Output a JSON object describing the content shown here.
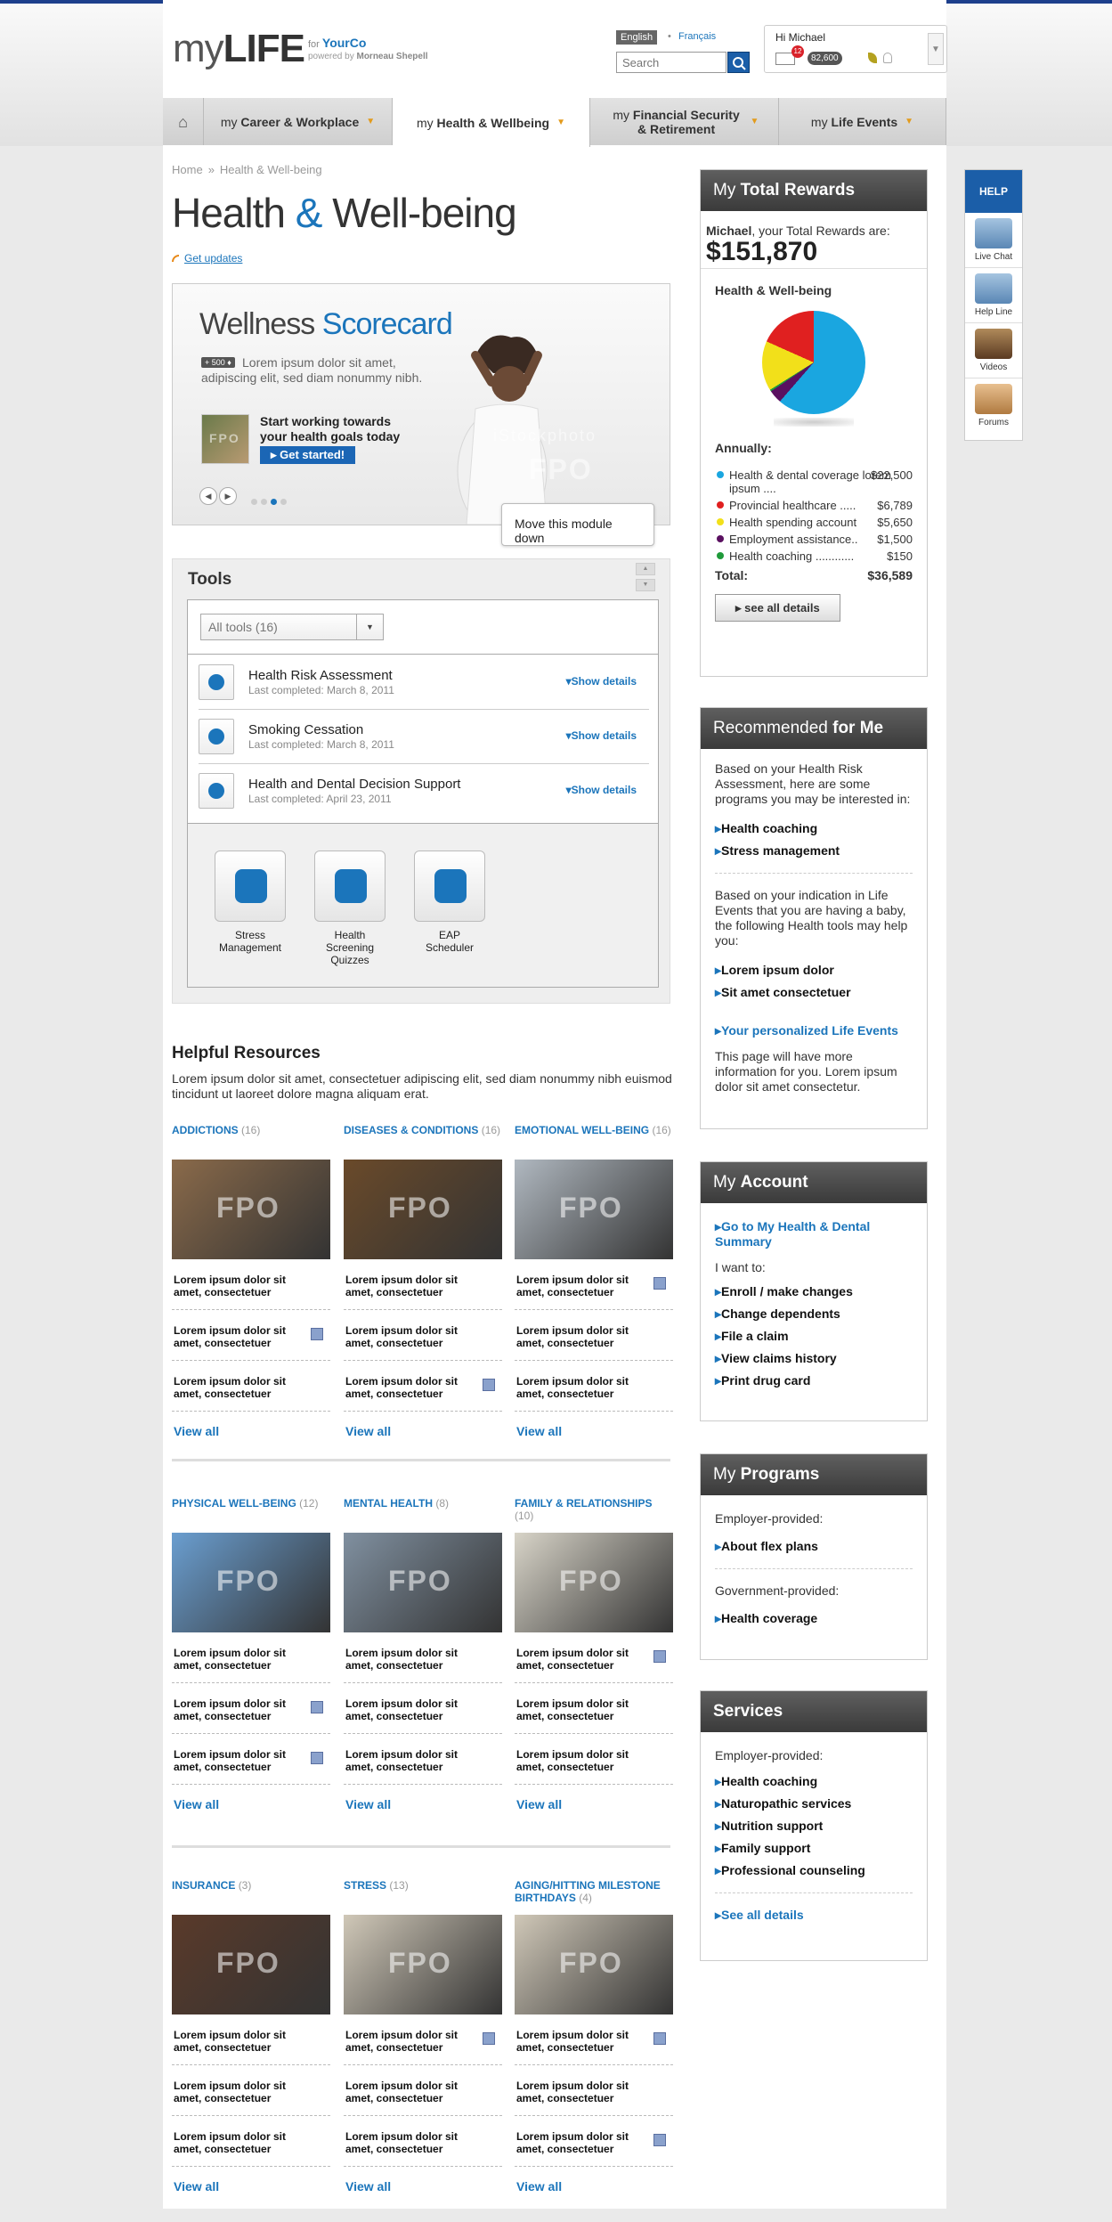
{
  "header": {
    "logo_my": "my",
    "logo_life": "LIFE",
    "for_label": "for",
    "company": "YourCo",
    "powered_by": "powered by",
    "powered_company": "Morneau Shepell",
    "lang_en": "English",
    "lang_sep": "•",
    "lang_fr": "Français",
    "search_placeholder": "Search",
    "greeting": "Hi Michael",
    "mail_count": "12",
    "points": "82,600"
  },
  "nav": {
    "tabs": [
      {
        "prefix": "my",
        "label": "Career & Workplace"
      },
      {
        "prefix": "my",
        "label": "Health & Wellbeing"
      },
      {
        "prefix": "my",
        "label": "Financial Security & Retirement"
      },
      {
        "prefix": "my",
        "label": "Life Events"
      }
    ]
  },
  "breadcrumb": {
    "home": "Home",
    "sep": "»",
    "current": "Health & Well-being"
  },
  "page_title": {
    "part1": "Health",
    "amp": "&",
    "part2": "Well-being"
  },
  "get_updates": "Get updates",
  "scorecard": {
    "title1": "Wellness",
    "title2": "Scorecard",
    "points_badge": "+ 500 ♦",
    "desc": "Lorem ipsum dolor sit amet, adipiscing elit, sed diam nonummy nibh.",
    "cta": "Start working towards your health goals today",
    "button": "Get started!",
    "fpo": "FPO",
    "watermark": "iStockphoto"
  },
  "tooltip": "Move this module down",
  "tools": {
    "title": "Tools",
    "filter": "All tools (16)",
    "rows": [
      {
        "name": "Health Risk Assessment",
        "date": "Last completed: March 8, 2011",
        "action": "Show details"
      },
      {
        "name": "Smoking Cessation",
        "date": "Last completed: March 8, 2011",
        "action": "Show details"
      },
      {
        "name": "Health and Dental Decision Support",
        "date": "Last completed: April 23, 2011",
        "action": "Show details"
      }
    ],
    "tiles": [
      {
        "label": "Stress Management",
        "icon": "weather-icon"
      },
      {
        "label": "Health Screening Quizzes",
        "icon": "clipboard-icon"
      },
      {
        "label": "EAP Scheduler",
        "icon": "alarm-clock-icon"
      }
    ]
  },
  "resources": {
    "title": "Helpful Resources",
    "desc": "Lorem ipsum dolor sit amet, consectetuer adipiscing elit, sed diam nonummy nibh euismod tincidunt ut laoreet dolore magna aliquam erat.",
    "view_all": "View all",
    "item1": "Lorem ipsum dolor sit amet, consectetuer",
    "item2": "Lorem ipsum dolor sit amet, consectetuer",
    "cats": [
      {
        "name": "ADDICTIONS",
        "count": "(16)"
      },
      {
        "name": "DISEASES & CONDITIONS",
        "count": "(16)"
      },
      {
        "name": "EMOTIONAL WELL-BEING",
        "count": "(16)"
      },
      {
        "name": "PHYSICAL WELL-BEING",
        "count": "(12)"
      },
      {
        "name": "MENTAL HEALTH",
        "count": "(8)"
      },
      {
        "name": "FAMILY & RELATIONSHIPS",
        "count": "(10)"
      },
      {
        "name": "INSURANCE",
        "count": "(3)"
      },
      {
        "name": "STRESS",
        "count": "(13)"
      },
      {
        "name": "AGING/HITTING MILESTONE BIRTHDAYS",
        "count": "(4)"
      }
    ]
  },
  "total_rewards": {
    "title1": "My",
    "title2": "Total Rewards",
    "name": "Michael",
    "intro": ", your Total Rewards are:",
    "value": "$151,870",
    "section": "Health & Well-being",
    "annually": "Annually:",
    "items": [
      {
        "label": "Health & dental coverage lorem ipsum ....",
        "amount": "$22,500",
        "color": "#1aa6e0"
      },
      {
        "label": "Provincial healthcare .....",
        "amount": "$6,789",
        "color": "#e02020"
      },
      {
        "label": "Health spending account",
        "amount": "$5,650",
        "color": "#f2e01a"
      },
      {
        "label": "Employment assistance..",
        "amount": "$1,500",
        "color": "#5a1060"
      },
      {
        "label": "Health coaching ............",
        "amount": "$150",
        "color": "#1f9a3a"
      }
    ],
    "total_label": "Total:",
    "total": "$36,589",
    "button": "see all details"
  },
  "recommended": {
    "title1": "Recommended",
    "title2": "for Me",
    "p1": "Based on your Health Risk Assessment, here are some programs you may be interested in:",
    "l1": "Health coaching",
    "l2": "Stress management",
    "p2": "Based on your indication in Life Events that you are having a baby, the following Health tools may help you:",
    "l3": "Lorem ipsum dolor",
    "l4": "Sit amet consectetuer",
    "l5": "Your personalized Life Events",
    "p3": "This page will have more information for you. Lorem ipsum dolor sit amet consectetur."
  },
  "account": {
    "title1": "My",
    "title2": "Account",
    "link": "Go to My Health & Dental Summary",
    "want": "I want to:",
    "items": [
      "Enroll / make changes",
      "Change dependents",
      "File a claim",
      "View claims history",
      "Print drug card"
    ]
  },
  "programs": {
    "title1": "My",
    "title2": "Programs",
    "emp": "Employer-provided:",
    "emp_link": "About flex plans",
    "gov": "Government-provided:",
    "gov_link": "Health coverage"
  },
  "services": {
    "title": "Services",
    "emp": "Employer-provided:",
    "items": [
      "Health coaching",
      "Naturopathic services",
      "Nutrition support",
      "Family support",
      "Professional counseling"
    ],
    "see_all": "See all details"
  },
  "help": {
    "title": "HELP",
    "items": [
      "Live Chat",
      "Help Line",
      "Videos",
      "Forums"
    ]
  }
}
